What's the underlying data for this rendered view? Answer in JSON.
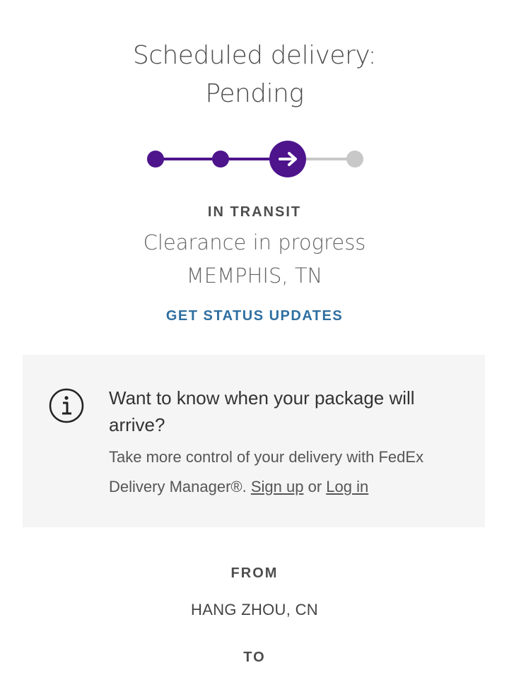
{
  "delivery": {
    "heading_line1": "Scheduled delivery:",
    "heading_line2": "Pending"
  },
  "progress": {
    "steps_total": 4,
    "steps_completed": 2,
    "current_step": 3,
    "current_icon": "arrow-right-icon",
    "colors": {
      "active": "#4d148c",
      "inactive": "#c8c8c8"
    }
  },
  "status": {
    "label": "IN TRANSIT",
    "detail": "Clearance in progress",
    "location": "MEMPHIS, TN",
    "updates_link": "GET STATUS UPDATES"
  },
  "info": {
    "icon": "info-icon",
    "title": "Want to know when your package will arrive?",
    "body_text": "Take more control of your delivery with FedEx Delivery Manager®.",
    "sign_up_label": "Sign up",
    "or_text": "or",
    "log_in_label": "Log in"
  },
  "shipment": {
    "from_label": "FROM",
    "from_value": "HANG ZHOU, CN",
    "to_label": "TO"
  }
}
